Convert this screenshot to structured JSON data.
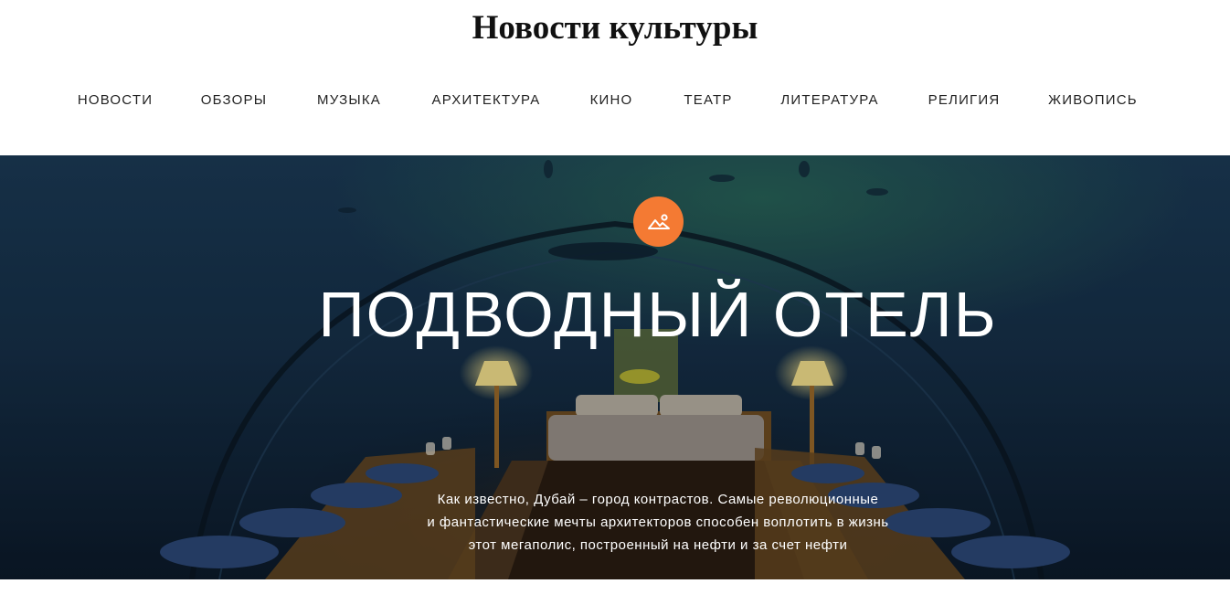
{
  "header": {
    "site_title": "Новости культуры"
  },
  "nav": {
    "items": [
      {
        "label": "НОВОСТИ"
      },
      {
        "label": "ОБЗОРЫ"
      },
      {
        "label": "МУЗЫКА"
      },
      {
        "label": "АРХИТЕКТУРА"
      },
      {
        "label": "КИНО"
      },
      {
        "label": "ТЕАТР"
      },
      {
        "label": "ЛИТЕРАТУРА"
      },
      {
        "label": "РЕЛИГИЯ"
      },
      {
        "label": "ЖИВОПИСЬ"
      }
    ]
  },
  "hero": {
    "icon": "image-icon",
    "title": "ПОДВОДНЫЙ ОТЕЛЬ",
    "text_lines": [
      "Как известно, Дубай – город контрастов. Самые революционные",
      "и фантастические мечты архитекторов способен воплотить в жизнь",
      "этот мегаполис, построенный на нефти и за счет нефти"
    ]
  },
  "colors": {
    "accent": "#f47a33",
    "nav_text": "#222222",
    "hero_text": "#ffffff"
  }
}
